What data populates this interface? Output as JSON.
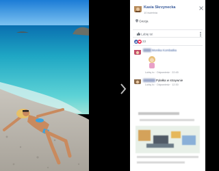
{
  "post": {
    "author_name": "Kasia Skrzynecka",
    "time": "10 kwietnia",
    "location": "Grecja"
  },
  "actions": {
    "like_label": "Lubię to!"
  },
  "reactions": {
    "count": "23"
  },
  "comments": [
    {
      "name": "Monika Kombatka",
      "time": "Lubię to · Odpowiedz · 22:45"
    },
    {
      "text": "Pyłałka w straywnie",
      "time": "Lubię to · Odpowiedz · 12:30"
    }
  ],
  "colors": {
    "link": "#365899",
    "like_blue": "#4267b2",
    "love_red": "#f0284a",
    "sea": "#1fa7c4"
  },
  "icons": [
    "close-icon",
    "location-pin-icon",
    "like-icon",
    "love-icon",
    "more-options-icon"
  ]
}
